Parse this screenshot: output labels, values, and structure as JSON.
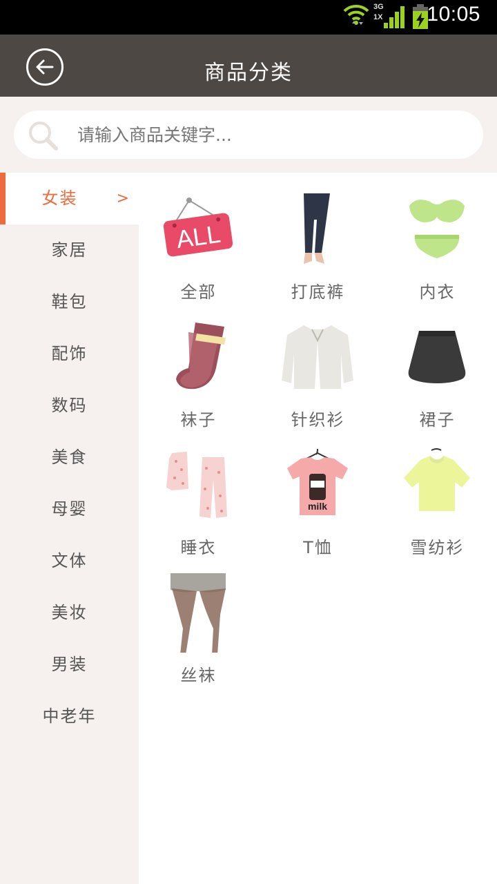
{
  "status_bar": {
    "network_type_top": "3G",
    "network_type_bottom": "1X",
    "time": "10:05"
  },
  "header": {
    "title": "商品分类",
    "back_icon": "back-arrow-icon"
  },
  "search": {
    "placeholder": "请输入商品关键字..."
  },
  "sidebar": {
    "active_arrow": ">",
    "items": [
      {
        "label": "女装"
      },
      {
        "label": "家居"
      },
      {
        "label": "鞋包"
      },
      {
        "label": "配饰"
      },
      {
        "label": "数码"
      },
      {
        "label": "美食"
      },
      {
        "label": "母婴"
      },
      {
        "label": "文体"
      },
      {
        "label": "美妆"
      },
      {
        "label": "男装"
      },
      {
        "label": "中老年"
      }
    ]
  },
  "categories": [
    {
      "label": "全部",
      "image": "all-sign-image",
      "badge_text": "ALL"
    },
    {
      "label": "打底裤",
      "image": "leggings-image"
    },
    {
      "label": "内衣",
      "image": "lingerie-image"
    },
    {
      "label": "袜子",
      "image": "socks-image"
    },
    {
      "label": "针织衫",
      "image": "cardigan-image"
    },
    {
      "label": "裙子",
      "image": "skirt-image"
    },
    {
      "label": "睡衣",
      "image": "pajamas-image"
    },
    {
      "label": "T恤",
      "image": "tshirt-image",
      "print_text": "milk"
    },
    {
      "label": "雪纺衫",
      "image": "chiffon-blouse-image"
    },
    {
      "label": "丝袜",
      "image": "stockings-image"
    }
  ],
  "colors": {
    "accent": "#ee6b3d",
    "header_bg": "#4d4844",
    "sidebar_bg": "#f6f1ee"
  }
}
